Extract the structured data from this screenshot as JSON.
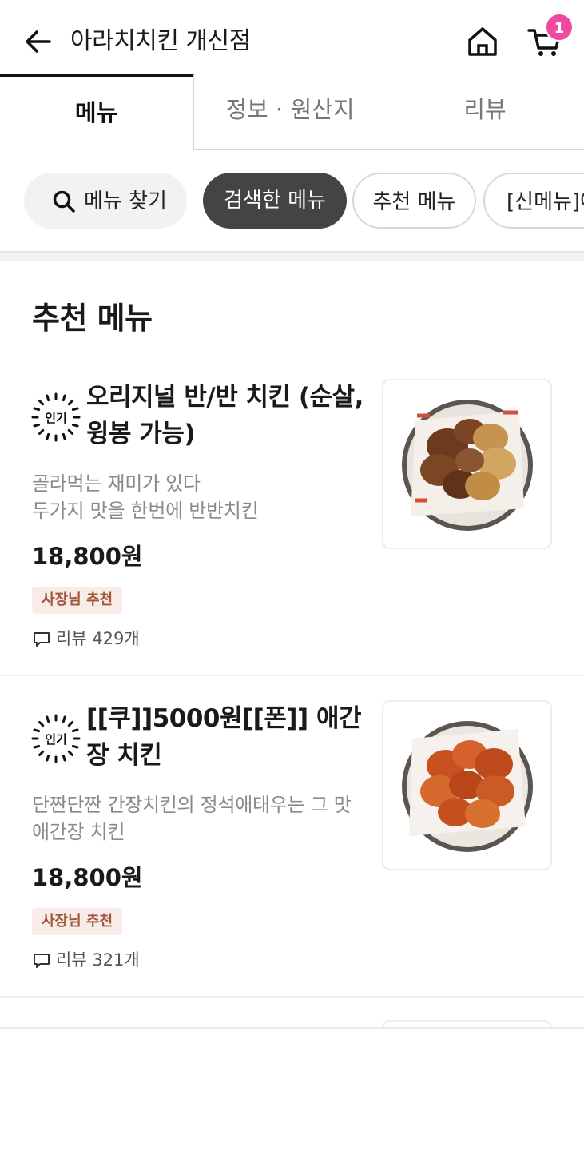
{
  "header": {
    "store_name": "아라치치킨 개신점",
    "cart_count": "1"
  },
  "tabs": [
    {
      "label": "메뉴",
      "active": true
    },
    {
      "label": "정보 · 원산지",
      "active": false
    },
    {
      "label": "리뷰",
      "active": false
    }
  ],
  "chips": {
    "search": "메뉴 찾기",
    "searched": "검색한 메뉴",
    "recommended": "추천 메뉴",
    "new_menu": "[신메뉴]아"
  },
  "section": {
    "title": "추천 메뉴"
  },
  "menu_items": [
    {
      "badge": "인기",
      "name": "오리지널 반/반 치킨 (순살,윙봉 가능)",
      "description": "골라먹는 재미가 있다\n두가지 맛을 한번에 반반치킨",
      "price": "18,800원",
      "tag": "사장님 추천",
      "review": "리뷰 429개"
    },
    {
      "badge": "인기",
      "name": "[[쿠]]5000원[[폰]] 애간장 치킨",
      "description": "단짠단짠 간장치킨의 정석애태우는 그 맛\n애간장 치킨",
      "price": "18,800원",
      "tag": "사장님 추천",
      "review": "리뷰 321개"
    }
  ],
  "colors": {
    "badge_pink": "#ee4aa0",
    "active_chip": "#444444",
    "owner_tag_bg": "#f7ece8",
    "owner_tag_text": "#a1553b"
  },
  "icons": [
    "back-arrow-icon",
    "home-icon",
    "cart-icon",
    "search-icon",
    "popular-badge-icon",
    "review-bubble-icon"
  ]
}
